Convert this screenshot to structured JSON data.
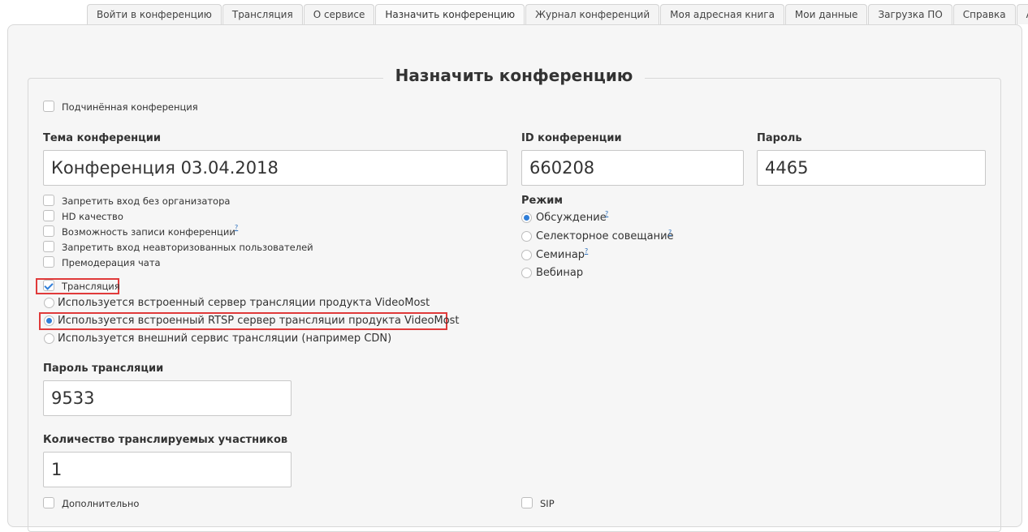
{
  "tabs": [
    {
      "label": "Войти в конференцию"
    },
    {
      "label": "Трансляция"
    },
    {
      "label": "О сервисе"
    },
    {
      "label": "Назначить конференцию",
      "active": true
    },
    {
      "label": "Журнал конференций"
    },
    {
      "label": "Моя адресная книга"
    },
    {
      "label": "Мои данные"
    },
    {
      "label": "Загрузка ПО"
    },
    {
      "label": "Справка"
    },
    {
      "label": "Админ"
    }
  ],
  "form": {
    "title": "Назначить конференцию",
    "subordinate_label": "Подчинённая конференция",
    "topic_label": "Тема конференции",
    "topic_value": "Конференция 03.04.2018",
    "id_label": "ID конференции",
    "id_value": "660208",
    "password_label": "Пароль",
    "password_value": "4465",
    "options": [
      {
        "label": "Запретить вход без организатора",
        "checked": false
      },
      {
        "label": "HD качество",
        "checked": false
      },
      {
        "label": "Возможность записи конференции",
        "checked": false,
        "help": "?"
      },
      {
        "label": "Запретить вход неавторизованных пользователей",
        "checked": false
      },
      {
        "label": "Премодерация чата",
        "checked": false
      }
    ],
    "mode_label": "Режим",
    "modes": [
      {
        "label": "Обсуждение",
        "checked": true,
        "help": "?"
      },
      {
        "label": "Селекторное совещание",
        "checked": false,
        "help": "?"
      },
      {
        "label": "Семинар",
        "checked": false,
        "help": "?"
      },
      {
        "label": "Вебинар",
        "checked": false
      }
    ],
    "broadcast_label": "Трансляция",
    "broadcast_checked": true,
    "broadcast_servers": [
      {
        "label": "Используется встроенный сервер трансляции продукта VideoMost",
        "checked": false
      },
      {
        "label": "Используется встроенный RTSP сервер трансляции продукта VideoMost",
        "checked": true
      },
      {
        "label": "Используется внешний сервис трансляции (например CDN)",
        "checked": false
      }
    ],
    "broadcast_password_label": "Пароль трансляции",
    "broadcast_password_value": "9533",
    "broadcast_count_label": "Количество транслируемых участников",
    "broadcast_count_value": "1",
    "extra_label": "Дополнительно",
    "sip_label": "SIP"
  },
  "colors": {
    "accent": "#2f7ed8",
    "highlight": "#e03a3a",
    "panel_bg": "#f6f6f6"
  }
}
